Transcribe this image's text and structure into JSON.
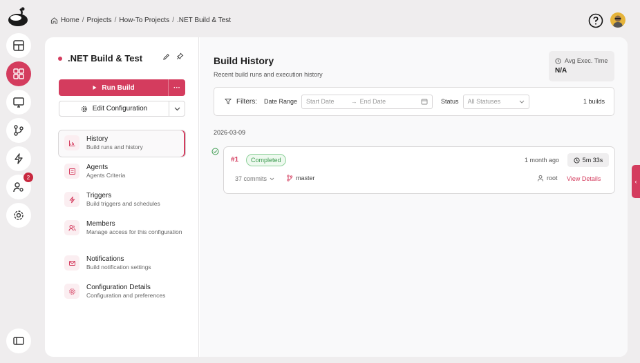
{
  "breadcrumb": {
    "items": [
      "Home",
      "Projects",
      "How-To Projects",
      ".NET Build & Test"
    ]
  },
  "rail": {
    "badge_count": "2"
  },
  "project": {
    "title": ".NET Build & Test",
    "run_label": "Run Build",
    "more_label": "···",
    "edit_label": "Edit Configuration"
  },
  "nav": {
    "items": [
      {
        "title": "History",
        "subtitle": "Build runs and history"
      },
      {
        "title": "Agents",
        "subtitle": "Agents Criteria"
      },
      {
        "title": "Triggers",
        "subtitle": "Build triggers and schedules"
      },
      {
        "title": "Members",
        "subtitle": "Manage access for this configuration"
      },
      {
        "title": "Notifications",
        "subtitle": "Build notification settings"
      },
      {
        "title": "Configuration Details",
        "subtitle": "Configuration and preferences"
      }
    ]
  },
  "history": {
    "title": "Build History",
    "subtitle": "Recent build runs and execution history",
    "avg_label": "Avg Exec. Time",
    "avg_value": "N/A"
  },
  "filters": {
    "label": "Filters:",
    "date_range_label": "Date Range",
    "start_placeholder": "Start Date",
    "end_placeholder": "End Date",
    "arrow": "→",
    "status_label": "Status",
    "status_value": "All Statuses",
    "count": "1 builds"
  },
  "builds": {
    "date": "2026-03-09",
    "items": [
      {
        "number": "#1",
        "status": "Completed",
        "ago": "1 month ago",
        "duration": "5m 33s",
        "commits": "37 commits",
        "branch": "master",
        "user": "root",
        "view_label": "View Details"
      }
    ]
  },
  "colors": {
    "accent": "#d43c5e",
    "success": "#3a9a4d"
  },
  "icons": {
    "side_tab": "‹"
  }
}
